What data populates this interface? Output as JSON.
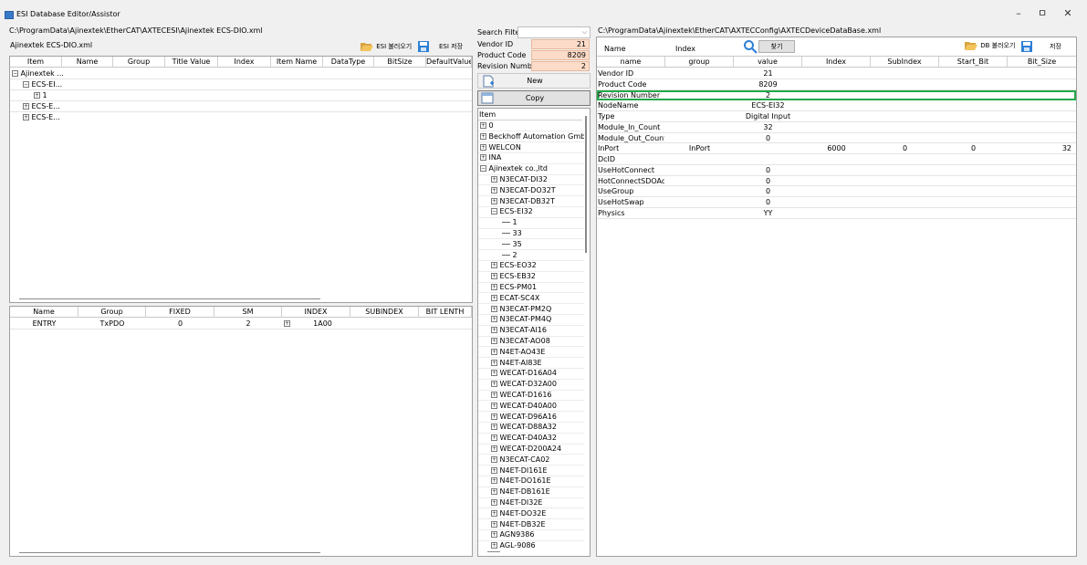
{
  "window": {
    "title": "ESI Database Editor/Assistor",
    "minimize": "–",
    "maximize": "ㅁ",
    "close": "✕"
  },
  "left": {
    "path": "C:\\ProgramData\\Ajinextek\\EtherCAT\\AXTECESI\\Ajinextek ECS-DIO.xml",
    "filename": "Ajinextek ECS-DIO.xml",
    "load_label": "ESI 불러오기",
    "save_label": "ESI 저장",
    "tree_columns": [
      "Item",
      "Name",
      "Group",
      "Title Value",
      "Index",
      "Item Name",
      "DataType",
      "BitSize",
      "DefaultValue"
    ],
    "tree_items": [
      "Ajinextek ...",
      "ECS-EI...",
      "1",
      "ECS-E...",
      "ECS-E..."
    ],
    "pdo_columns": [
      "Name",
      "Group",
      "FIXED",
      "SM",
      "INDEX",
      "SUBINDEX",
      "BIT LENTH"
    ],
    "pdo_rows": [
      [
        "ENTRY",
        "TxPDO",
        "0",
        "2",
        "1A00",
        "",
        ""
      ]
    ]
  },
  "middle": {
    "search_label": "Search Filter",
    "search_value": "",
    "vendor_label": "Vendor ID",
    "vendor_value": "21",
    "product_label": "Product Code",
    "product_value": "8209",
    "revision_label": "Revision Number",
    "revision_value": "2",
    "new_label": "New",
    "copy_label": "Copy",
    "item_header": "Item",
    "tree": [
      {
        "label": "0",
        "level": 0,
        "expander": "+"
      },
      {
        "label": "Beckhoff Automation GmbH",
        "level": 0,
        "expander": "+"
      },
      {
        "label": "WELCON",
        "level": 0,
        "expander": "+"
      },
      {
        "label": "INA",
        "level": 0,
        "expander": "+"
      },
      {
        "label": "Ajinextek co.,ltd",
        "level": 0,
        "expander": "-"
      },
      {
        "label": "N3ECAT-DI32",
        "level": 1,
        "expander": "+"
      },
      {
        "label": "N3ECAT-DO32T",
        "level": 1,
        "expander": "+"
      },
      {
        "label": "N3ECAT-DB32T",
        "level": 1,
        "expander": "+"
      },
      {
        "label": "ECS-EI32",
        "level": 1,
        "expander": "-"
      },
      {
        "label": "1",
        "level": 2,
        "expander": ""
      },
      {
        "label": "33",
        "level": 2,
        "expander": ""
      },
      {
        "label": "35",
        "level": 2,
        "expander": ""
      },
      {
        "label": "2",
        "level": 2,
        "expander": ""
      },
      {
        "label": "ECS-EO32",
        "level": 1,
        "expander": "+"
      },
      {
        "label": "ECS-EB32",
        "level": 1,
        "expander": "+"
      },
      {
        "label": "ECS-PM01",
        "level": 1,
        "expander": "+"
      },
      {
        "label": "ECAT-SC4X",
        "level": 1,
        "expander": "+"
      },
      {
        "label": "N3ECAT-PM2Q",
        "level": 1,
        "expander": "+"
      },
      {
        "label": "N3ECAT-PM4Q",
        "level": 1,
        "expander": "+"
      },
      {
        "label": "N3ECAT-AI16",
        "level": 1,
        "expander": "+"
      },
      {
        "label": "N3ECAT-AO08",
        "level": 1,
        "expander": "+"
      },
      {
        "label": "N4ET-AO43E",
        "level": 1,
        "expander": "+"
      },
      {
        "label": "N4ET-AI83E",
        "level": 1,
        "expander": "+"
      },
      {
        "label": "WECAT-D16A04",
        "level": 1,
        "expander": "+"
      },
      {
        "label": "WECAT-D32A00",
        "level": 1,
        "expander": "+"
      },
      {
        "label": "WECAT-D1616",
        "level": 1,
        "expander": "+"
      },
      {
        "label": "WECAT-D40A00",
        "level": 1,
        "expander": "+"
      },
      {
        "label": "WECAT-D96A16",
        "level": 1,
        "expander": "+"
      },
      {
        "label": "WECAT-D88A32",
        "level": 1,
        "expander": "+"
      },
      {
        "label": "WECAT-D40A32",
        "level": 1,
        "expander": "+"
      },
      {
        "label": "WECAT-D200A24",
        "level": 1,
        "expander": "+"
      },
      {
        "label": "N3ECAT-CA02",
        "level": 1,
        "expander": "+"
      },
      {
        "label": "N4ET-DI161E",
        "level": 1,
        "expander": "+"
      },
      {
        "label": "N4ET-DO161E",
        "level": 1,
        "expander": "+"
      },
      {
        "label": "N4ET-DB161E",
        "level": 1,
        "expander": "+"
      },
      {
        "label": "N4ET-DI32E",
        "level": 1,
        "expander": "+"
      },
      {
        "label": "N4ET-DO32E",
        "level": 1,
        "expander": "+"
      },
      {
        "label": "N4ET-DB32E",
        "level": 1,
        "expander": "+"
      },
      {
        "label": "AGN9386",
        "level": 1,
        "expander": "+"
      },
      {
        "label": "AGL-9086",
        "level": 1,
        "expander": "+"
      }
    ]
  },
  "right": {
    "path": "C:\\ProgramData\\Ajinextek\\EtherCAT\\AXTECConfig\\AXTECDeviceDataBase.xml",
    "name_label": "Name",
    "index_label": "Index",
    "find_label": "찾기",
    "db_load_label": "DB 불러오기",
    "save_label": "저장",
    "columns": [
      "name",
      "group",
      "value",
      "Index",
      "SubIndex",
      "Start_Bit",
      "Bit_Size"
    ],
    "rows": [
      [
        "Vendor ID",
        "",
        "21",
        "",
        "",
        "",
        ""
      ],
      [
        "Product Code",
        "",
        "8209",
        "",
        "",
        "",
        ""
      ],
      [
        "Revision Number",
        "",
        "2",
        "",
        "",
        "",
        ""
      ],
      [
        "NodeName",
        "",
        "ECS-EI32",
        "",
        "",
        "",
        ""
      ],
      [
        "Type",
        "",
        "Digital Input",
        "",
        "",
        "",
        ""
      ],
      [
        "Module_In_Count",
        "",
        "32",
        "",
        "",
        "",
        ""
      ],
      [
        "Module_Out_Count",
        "",
        "0",
        "",
        "",
        "",
        ""
      ],
      [
        "InPort",
        "InPort",
        "",
        "6000",
        "0",
        "0",
        "32"
      ],
      [
        "DcID",
        "",
        "",
        "",
        "",
        "",
        ""
      ],
      [
        "UseHotConnect",
        "",
        "0",
        "",
        "",
        "",
        ""
      ],
      [
        "HotConnectSDOAd...",
        "",
        "0",
        "",
        "",
        "",
        ""
      ],
      [
        "UseGroup",
        "",
        "0",
        "",
        "",
        "",
        ""
      ],
      [
        "UseHotSwap",
        "",
        "0",
        "",
        "",
        "",
        ""
      ],
      [
        "Physics",
        "",
        "YY",
        "",
        "",
        "",
        ""
      ]
    ],
    "highlight_color": "#22a84a"
  }
}
